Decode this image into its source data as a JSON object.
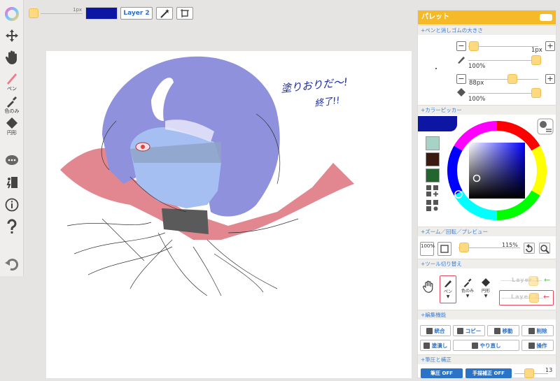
{
  "toolbar": {
    "items": [
      {
        "icon": "color-wheel-icon",
        "label": ""
      },
      {
        "icon": "move-icon",
        "label": ""
      },
      {
        "icon": "hand-icon",
        "label": ""
      },
      {
        "icon": "pen-icon",
        "label": "ペン"
      },
      {
        "icon": "eyedropper-icon",
        "label": "色のみ"
      },
      {
        "icon": "circle-shape-icon",
        "label": "円形"
      },
      {
        "icon": "chat-icon",
        "label": ""
      },
      {
        "icon": "exit-icon",
        "label": ""
      },
      {
        "icon": "info-icon",
        "label": ""
      },
      {
        "icon": "help-icon",
        "label": ""
      },
      {
        "icon": "undo-icon",
        "label": ""
      }
    ]
  },
  "topbar": {
    "size_value": "1px",
    "color": "#0d15a3",
    "layer_label": "Layer 2"
  },
  "canvas": {
    "handwriting_line1": "塗りおりだ〜!",
    "handwriting_line2": "終了!!"
  },
  "panel": {
    "title": "パレット",
    "sections": {
      "pen_size": "+ペンと消しゴムの大きさ",
      "color_picker": "+カラーピッカー",
      "zoom": "+ズーム／回転／プレビュー",
      "tool_switch": "+ツール切り替え",
      "edit": "+編集機能",
      "pressure": "+筆圧と補正"
    },
    "pen": {
      "size": "1px",
      "opacity": "100%",
      "size_level": 0.05,
      "opacity_level": 1.0
    },
    "eraser": {
      "size": "88px",
      "opacity": "100%",
      "size_level": 0.62,
      "opacity_level": 1.0
    },
    "current_color": "#0d15a3",
    "palette_colors": [
      "#a6d3c6",
      "#3b1a10",
      "#22662e"
    ],
    "zoom": {
      "button": "100%",
      "value": "115%",
      "level": 0.1
    },
    "tools": {
      "pen": "ペン",
      "eyedropper": "色のみ",
      "eraser": "円形"
    },
    "layers": [
      {
        "name": "Layer 1"
      },
      {
        "name": "Layer 2"
      }
    ],
    "edit_buttons": [
      "統合",
      "コピー",
      "移動",
      "削除",
      "塗潰し",
      "やり直し",
      "操作"
    ],
    "pressure": {
      "pressure_btn": "筆圧 OFF",
      "correction_btn": "手描補正 OFF",
      "value": "13",
      "level": 0.9
    }
  }
}
